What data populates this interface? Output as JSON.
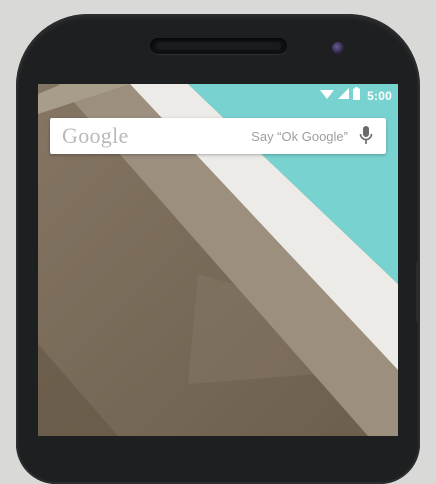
{
  "status_bar": {
    "time": "5:00",
    "icons": [
      "wifi-icon",
      "cellular-signal-icon",
      "battery-icon"
    ]
  },
  "search_bar": {
    "logo_text": "Google",
    "hint": "Say “Ok Google”",
    "icon": "microphone-icon"
  },
  "colors": {
    "wallpaper_teal": "#78d3d0",
    "wallpaper_stripe": "#ecebe7",
    "wallpaper_wall": "#7a6b57",
    "phone_body": "#1e1f21"
  }
}
